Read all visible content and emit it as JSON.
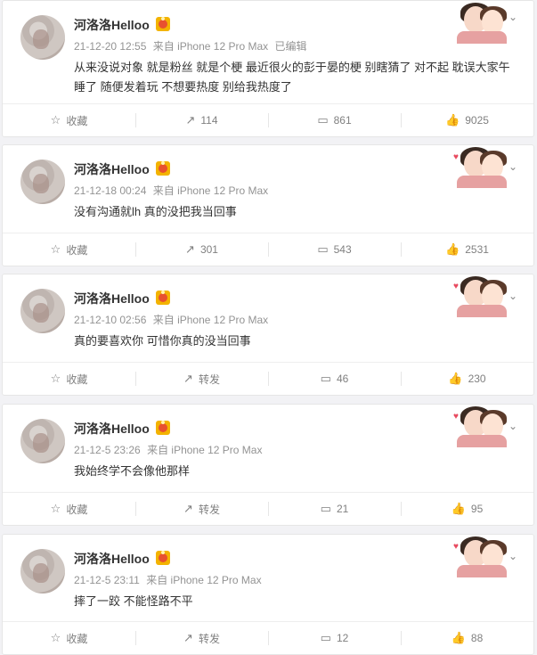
{
  "posts": [
    {
      "name": "河洛洛Helloo",
      "time": "21-12-20 12:55",
      "source": "来自 iPhone 12 Pro Max",
      "edited": "已编辑",
      "text": "从来没说对象 就是粉丝 就是个梗 最近很火的彭于晏的梗 别瞎猜了  对不起 耽误大家午睡了 随便发着玩 不想要热度 别给我热度了",
      "actions": {
        "collect": "收藏",
        "repost": "114",
        "comment": "861",
        "like": "9025"
      }
    },
    {
      "name": "河洛洛Helloo",
      "time": "21-12-18 00:24",
      "source": "来自 iPhone 12 Pro Max",
      "edited": "",
      "text": "没有沟通就lh 真的没把我当回事",
      "actions": {
        "collect": "收藏",
        "repost": "301",
        "comment": "543",
        "like": "2531"
      }
    },
    {
      "name": "河洛洛Helloo",
      "time": "21-12-10 02:56",
      "source": "来自 iPhone 12 Pro Max",
      "edited": "",
      "text": "真的要喜欢你 可惜你真的没当回事",
      "actions": {
        "collect": "收藏",
        "repost": "转发",
        "comment": "46",
        "like": "230"
      }
    },
    {
      "name": "河洛洛Helloo",
      "time": "21-12-5 23:26",
      "source": "来自 iPhone 12 Pro Max",
      "edited": "",
      "text": "我始终学不会像他那样",
      "actions": {
        "collect": "收藏",
        "repost": "转发",
        "comment": "21",
        "like": "95"
      }
    },
    {
      "name": "河洛洛Helloo",
      "time": "21-12-5 23:11",
      "source": "来自 iPhone 12 Pro Max",
      "edited": "",
      "text": "摔了一跤 不能怪路不平",
      "actions": {
        "collect": "收藏",
        "repost": "转发",
        "comment": "12",
        "like": "88"
      }
    }
  ],
  "icons": {
    "collect": "star-icon",
    "repost": "repost-icon",
    "comment": "comment-icon",
    "like": "thumbs-up-icon",
    "more": "chevron-down-icon",
    "badge": "vip-badge-icon"
  }
}
